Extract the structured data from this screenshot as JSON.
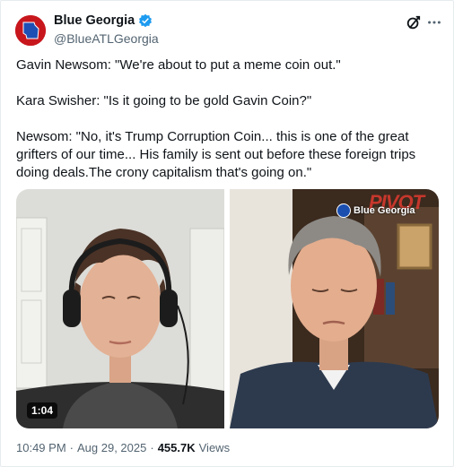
{
  "author": {
    "display_name": "Blue Georgia",
    "handle": "@BlueATLGeorgia",
    "verified_icon": "verified-badge-icon"
  },
  "tweet": {
    "text": "Gavin Newsom: \"We're about to put a meme coin out.\"\n\nKara Swisher: \"Is it going to be gold Gavin Coin?\"\n\nNewsom: \"No, it's Trump Corruption Coin... this is one of the great grifters of our time... His family is sent out before these foreign trips doing deals.The crony capitalism that's going on.\""
  },
  "media": {
    "duration": "1:04",
    "watermark_logo_text": "PIVOT",
    "watermark_channel": "Blue Georgia"
  },
  "meta": {
    "time": "10:49 PM",
    "separator": "·",
    "date": "Aug 29, 2025",
    "views_count": "455.7K",
    "views_label": "Views"
  },
  "colors": {
    "accent": "#1d9bf0",
    "text": "#0f1419",
    "secondary": "#536471"
  }
}
